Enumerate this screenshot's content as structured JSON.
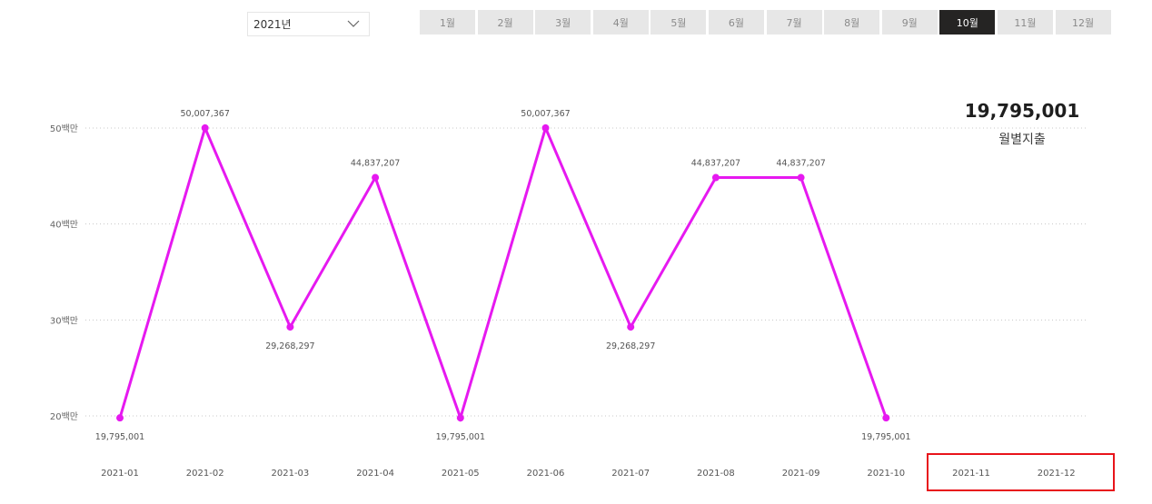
{
  "filters": {
    "year": "2021년",
    "months": [
      "1월",
      "2월",
      "3월",
      "4월",
      "5월",
      "6월",
      "7월",
      "8월",
      "9월",
      "10월",
      "11월",
      "12월"
    ],
    "active_month_index": 9
  },
  "kpi": {
    "value": "19,795,001",
    "label": "월별지출"
  },
  "colors": {
    "series": "#e619f0",
    "active_button": "#252423",
    "button": "#e7e7e7",
    "highlight_box": "#e8141b"
  },
  "chart_data": {
    "type": "line",
    "x": [
      "2021-01",
      "2021-02",
      "2021-03",
      "2021-04",
      "2021-05",
      "2021-06",
      "2021-07",
      "2021-08",
      "2021-09",
      "2021-10",
      "2021-11",
      "2021-12"
    ],
    "series": [
      {
        "values": [
          19795001,
          50007367,
          29268297,
          44837207,
          19795001,
          50007367,
          29268297,
          44837207,
          44837207,
          19795001,
          null,
          null
        ],
        "labels": [
          "19,795,001",
          "50,007,367",
          "29,268,297",
          "44,837,207",
          "19,795,001",
          "50,007,367",
          "29,268,297",
          "44,837,207",
          "44,837,207",
          "19,795,001"
        ],
        "label_pos": [
          "below",
          "above",
          "below",
          "above",
          "below",
          "above",
          "below",
          "above",
          "above",
          "below"
        ]
      }
    ],
    "y_ticks": [
      {
        "value": 20000000,
        "label": "20백만"
      },
      {
        "value": 30000000,
        "label": "30백만"
      },
      {
        "value": 40000000,
        "label": "40백만"
      },
      {
        "value": 50000000,
        "label": "50백만"
      }
    ],
    "ylim": [
      20000000,
      50000000
    ],
    "grid": true,
    "legend": "none"
  }
}
